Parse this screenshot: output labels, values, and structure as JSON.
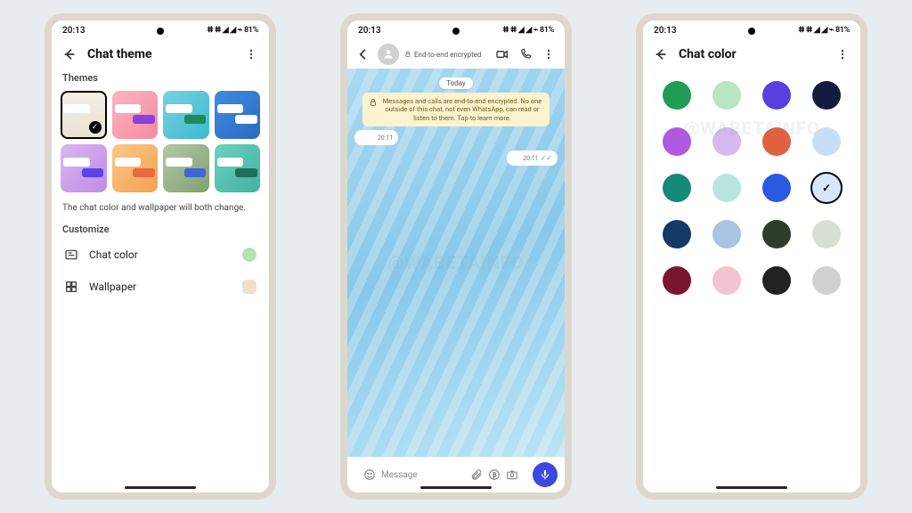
{
  "status": {
    "time": "20:13",
    "battery": "81%",
    "icons": "ⵌ ⵌ ◢ ◢ ⌁"
  },
  "watermark": "@WABETAINFO",
  "screen1": {
    "title": "Chat theme",
    "themes_label": "Themes",
    "helper": "The chat color and wallpaper will both change.",
    "customize_label": "Customize",
    "chat_color_label": "Chat color",
    "wallpaper_label": "Wallpaper",
    "themes": [
      {
        "out": "#f1e6d3",
        "selected": true
      },
      {
        "out": "#8a3fe0"
      },
      {
        "out": "#1f8a5a"
      },
      {
        "out": "#ffffff"
      },
      {
        "out": "#5a44e8"
      },
      {
        "out": "#e86a3f"
      },
      {
        "out": "#3f66d6"
      },
      {
        "out": "#1f6e5a"
      }
    ],
    "chat_color_swatch": "#b8e0b8",
    "wallpaper_swatch": "#f1dfce"
  },
  "screen2": {
    "encrypted_label": "End-to-end encrypted",
    "today": "Today",
    "notice": "Messages and calls are end-to-end encrypted. No one outside of this chat, not even WhatsApp, can read or listen to them. Tap to learn more.",
    "msg_in_time": "20:11",
    "msg_out_time": "20:11",
    "input_placeholder": "Message"
  },
  "screen3": {
    "title": "Chat color",
    "colors": [
      "#1f9d55",
      "#b8e6c0",
      "#5a3fe0",
      "#151b3d",
      "#b05ae0",
      "#d7b8ef",
      "#e0603f",
      "#c7dff5",
      "#158a78",
      "#b8e6df",
      "#2a5ae0",
      "#d7e6f9",
      "#143a66",
      "#a8c4e0",
      "#2e3d2a",
      "#d7e0d3",
      "#7a1530",
      "#f1c4d0",
      "#222222",
      "#d0d0d0"
    ],
    "selected_index": 11
  }
}
